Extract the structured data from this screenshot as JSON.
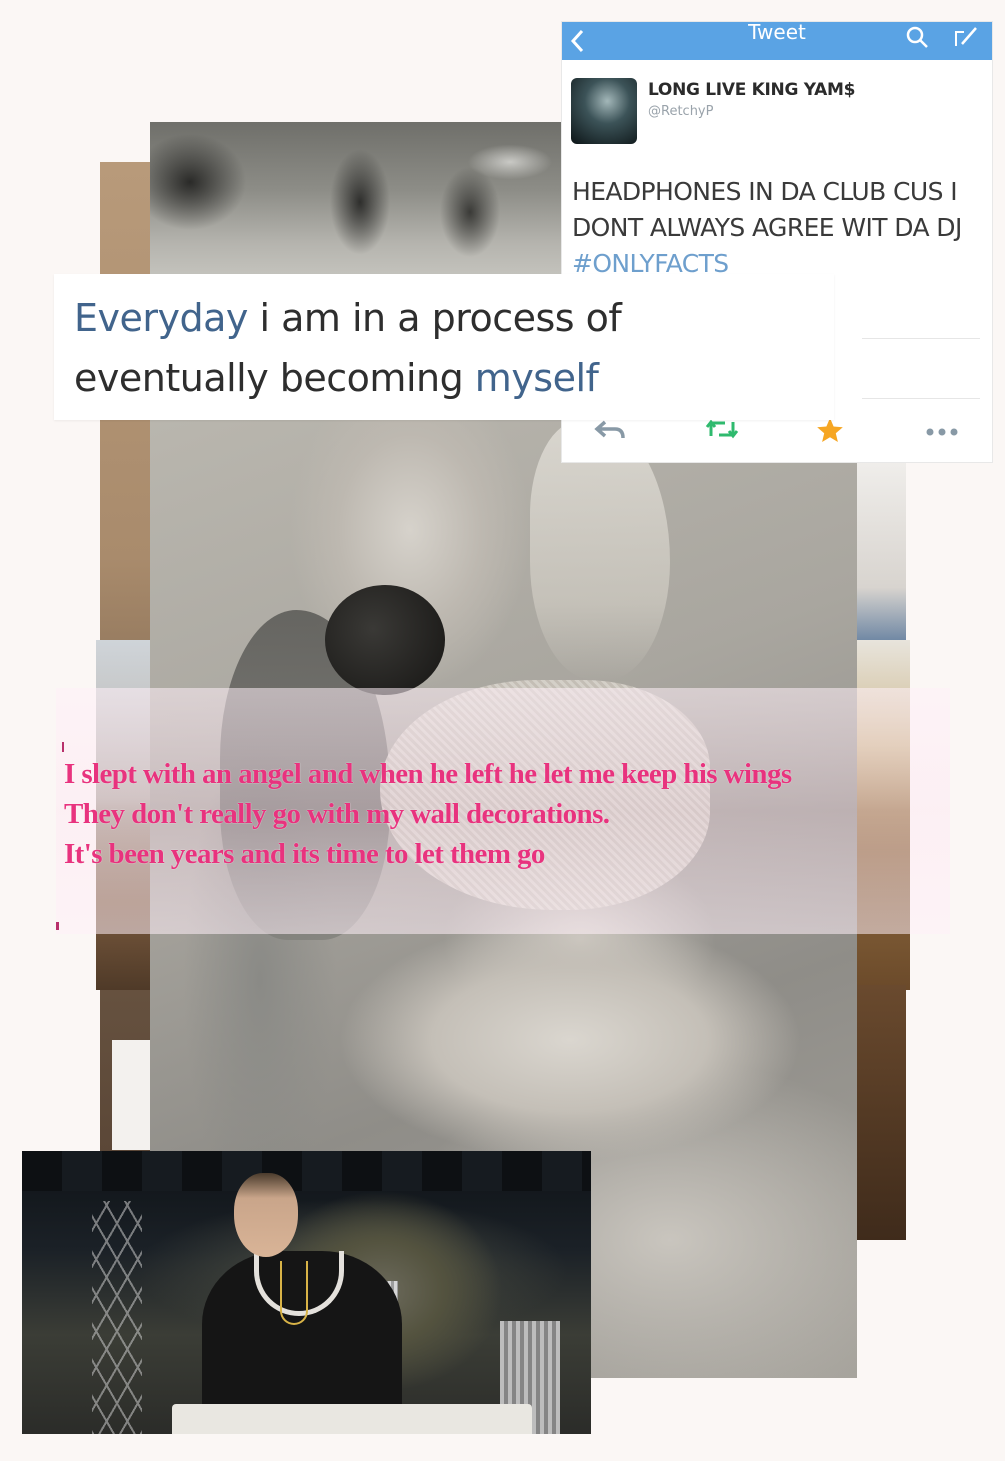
{
  "tweet": {
    "title": "Tweet",
    "display_name": "LONG LIVE KING YAM$",
    "handle": "@RetchyP",
    "body_text": "HEADPHONES IN DA CLUB CUS I DONT ALWAYS AGREE WIT DA DJ ",
    "hashtag": "#ONLYFACTS",
    "icons": [
      "back-icon",
      "search-icon",
      "compose-icon",
      "reply-icon",
      "retweet-icon",
      "favorite-icon",
      "more-icon"
    ],
    "colors": {
      "bar": "#5aa3e4",
      "hashtag": "#6e9fcd",
      "retweet": "#2fba6e",
      "favorite": "#f6a623"
    }
  },
  "quote": {
    "highlight_1": "Everyday",
    "text_1": " i am in a process of",
    "text_2": "eventually becoming ",
    "highlight_2": "myself",
    "colors": {
      "highlight": "#41648c",
      "text": "#2e2e2e"
    }
  },
  "poem": {
    "lines": [
      "I slept with an angel and when he left he let me keep his wings",
      "They don't really go with my wall decorations.",
      "It's been years and its time to let them go"
    ],
    "color": "#e8337e"
  }
}
